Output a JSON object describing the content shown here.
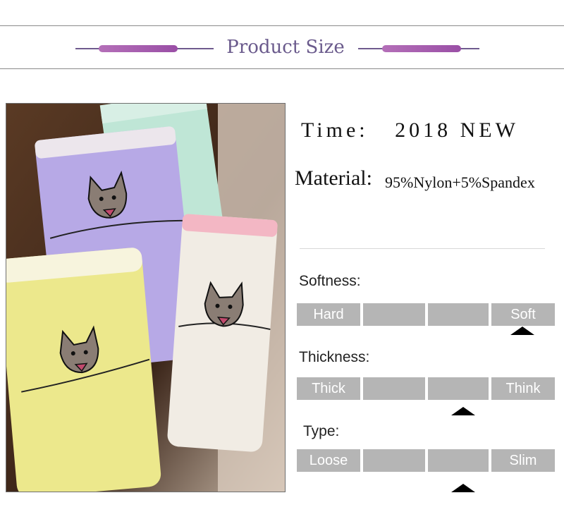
{
  "header": {
    "title": "Product Size"
  },
  "product": {
    "time_label": "Time:",
    "time_value": "2018 NEW",
    "material_label": "Material:",
    "material_value": "95%Nylon+5%Spandex"
  },
  "scales": [
    {
      "label": "Softness:",
      "left": "Hard",
      "right": "Soft",
      "selected_segment": 4,
      "segments": 4
    },
    {
      "label": "Thickness:",
      "left": "Thick",
      "right": "Think",
      "selected_segment": 3,
      "segments": 4
    },
    {
      "label": "Type:",
      "left": "Loose",
      "right": "Slim",
      "selected_segment": 3,
      "segments": 4
    }
  ],
  "colors": {
    "accent": "#6a5a8c",
    "pill": "#a65cb0",
    "scale_bar": "#b5b5b5",
    "marker": "#000000"
  }
}
